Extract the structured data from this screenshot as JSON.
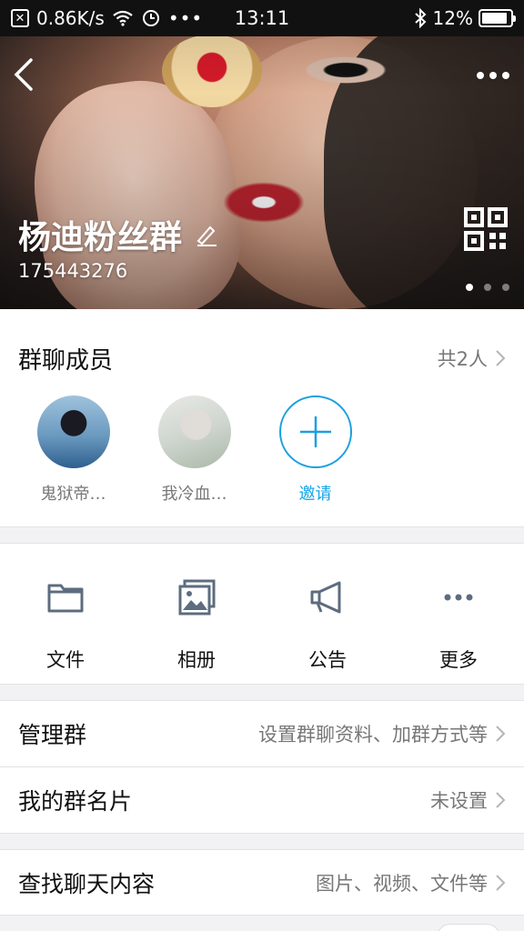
{
  "status_bar": {
    "network_speed": "0.86K/s",
    "time": "13:11",
    "battery_percent": "12%",
    "battery_level": 0.9
  },
  "header": {
    "group_name": "杨迪粉丝群",
    "group_id": "175443276",
    "photo_page_index": 0,
    "photo_page_count": 3
  },
  "members": {
    "title": "群聊成员",
    "count_label": "共2人",
    "items": [
      {
        "name": "鬼狱帝…"
      },
      {
        "name": "我冷血…"
      }
    ],
    "invite_label": "邀请"
  },
  "tools": [
    {
      "label": "文件",
      "icon": "folder-icon"
    },
    {
      "label": "相册",
      "icon": "album-icon"
    },
    {
      "label": "公告",
      "icon": "megaphone-icon"
    },
    {
      "label": "更多",
      "icon": "more-icon"
    }
  ],
  "settings": {
    "manage": {
      "label": "管理群",
      "value": "设置群聊资料、加群方式等"
    },
    "card": {
      "label": "我的群名片",
      "value": "未设置"
    },
    "search": {
      "label": "查找聊天内容",
      "value": "图片、视频、文件等"
    }
  },
  "colors": {
    "accent": "#12a4e8",
    "text_primary": "#111111",
    "text_secondary": "#777777",
    "background": "#f2f2f4"
  }
}
